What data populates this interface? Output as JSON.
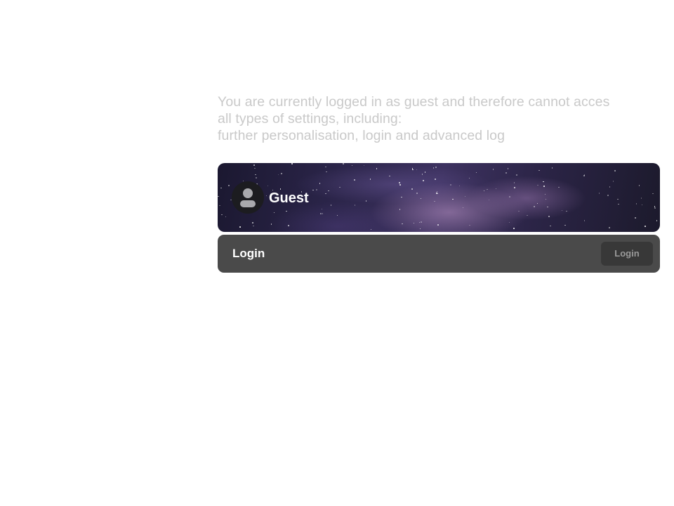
{
  "notice": {
    "lines": [
      "You are currently logged in as guest and therefore cannot acces",
      "all types of settings, including:",
      "further personalisation, login and advanced log"
    ]
  },
  "profile": {
    "name": "Guest",
    "avatar_icon": "user-icon",
    "banner": "starry-night-sky"
  },
  "login_row": {
    "label": "Login",
    "button_label": "Login"
  },
  "colors": {
    "notice_text": "#c9c9c9",
    "login_row_bg": "#4a4a4a",
    "login_button_bg": "#383838",
    "login_button_text": "#9a9a9a"
  }
}
